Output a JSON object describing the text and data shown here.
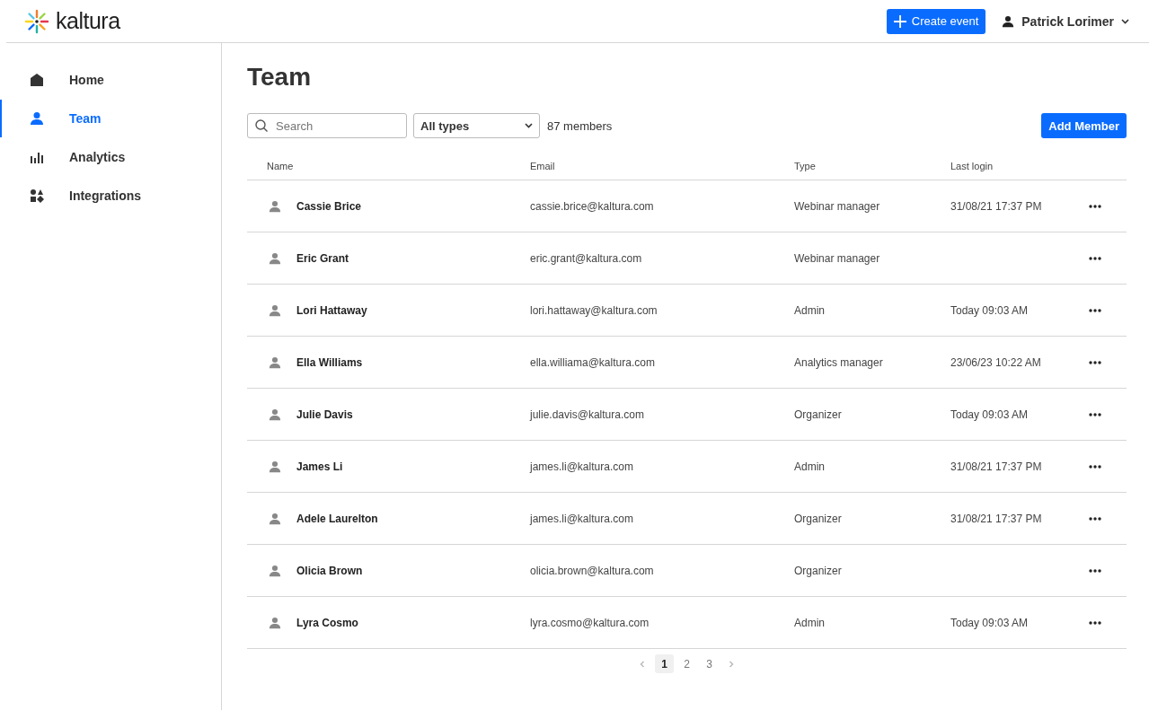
{
  "header": {
    "logo_text": "kaltura",
    "create_button": "Create event",
    "user_name": "Patrick Lorimer"
  },
  "sidebar": {
    "items": [
      {
        "label": "Home",
        "selected": false
      },
      {
        "label": "Team",
        "selected": true
      },
      {
        "label": "Analytics",
        "selected": false
      },
      {
        "label": "Integrations",
        "selected": false
      }
    ]
  },
  "page": {
    "title": "Team",
    "search": {
      "placeholder": "Search"
    },
    "type_filter": "All types",
    "member_count": "87 members",
    "add_button": "Add Member"
  },
  "table": {
    "columns": [
      "Name",
      "Email",
      "Type",
      "Last login"
    ],
    "rows": [
      {
        "name": "Cassie Brice",
        "email": "cassie.brice@kaltura.com",
        "type": "Webinar manager",
        "last_login": "31/08/21 17:37 PM"
      },
      {
        "name": "Eric Grant",
        "email": "eric.grant@kaltura.com",
        "type": "Webinar manager"
      },
      {
        "name": "Lori Hattaway",
        "email": "lori.hattaway@kaltura.com",
        "type": "Admin",
        "last_login": "Today 09:03 AM"
      },
      {
        "name": "Ella Williams",
        "email": "ella.williama@kaltura.com",
        "type": "Analytics manager",
        "last_login": "23/06/23 10:22 AM"
      },
      {
        "name": "Julie Davis",
        "email": "julie.davis@kaltura.com",
        "type": "Organizer",
        "last_login": "Today 09:03 AM"
      },
      {
        "name": "James Li",
        "email": "james.li@kaltura.com",
        "type": "Admin",
        "last_login": "31/08/21 17:37 PM"
      },
      {
        "name": "Adele Laurelton",
        "email": "james.li@kaltura.com",
        "type": "Organizer",
        "last_login": "31/08/21 17:37 PM"
      },
      {
        "name": "Olicia Brown",
        "email": "olicia.brown@kaltura.com",
        "type": "Organizer"
      },
      {
        "name": "Lyra Cosmo",
        "email": "lyra.cosmo@kaltura.com",
        "type": "Admin",
        "last_login": "Today 09:03 AM"
      }
    ]
  },
  "pagination": {
    "pages": [
      {
        "label": "1",
        "selected": true
      },
      {
        "label": "2",
        "selected": false
      },
      {
        "label": "3",
        "selected": false
      }
    ]
  }
}
